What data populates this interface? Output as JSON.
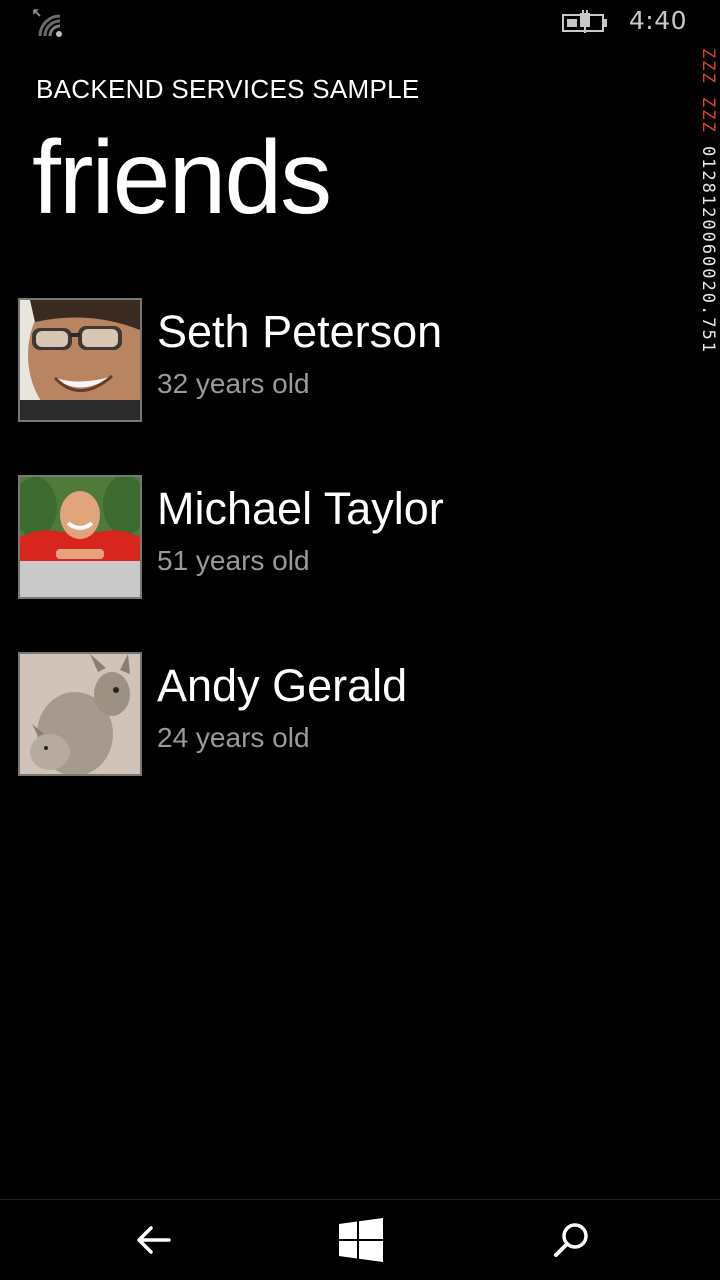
{
  "status_bar": {
    "time": "4:40",
    "signal_icon": "wifi-signal-icon",
    "battery_icon": "battery-charging-icon"
  },
  "frame_counter": {
    "alert_top": "ZZZ",
    "alert_second": "ZZZ",
    "values": "0128120060020.751"
  },
  "header": {
    "app_title": "BACKEND SERVICES SAMPLE",
    "page_title": "friends"
  },
  "friends": [
    {
      "name": "Seth Peterson",
      "age": "32 years old",
      "avatar": "man-with-glasses-photo"
    },
    {
      "name": "Michael Taylor",
      "age": "51 years old",
      "avatar": "man-in-red-shirt-photo"
    },
    {
      "name": "Andy Gerald",
      "age": "24 years old",
      "avatar": "kangaroo-photo"
    }
  ],
  "nav": {
    "back_icon": "back-arrow-icon",
    "home_icon": "windows-logo-icon",
    "search_icon": "search-icon"
  },
  "colors": {
    "background": "#000000",
    "text_primary": "#ffffff",
    "text_secondary": "#9a9a9a",
    "counter_alert": "#e0412a"
  }
}
